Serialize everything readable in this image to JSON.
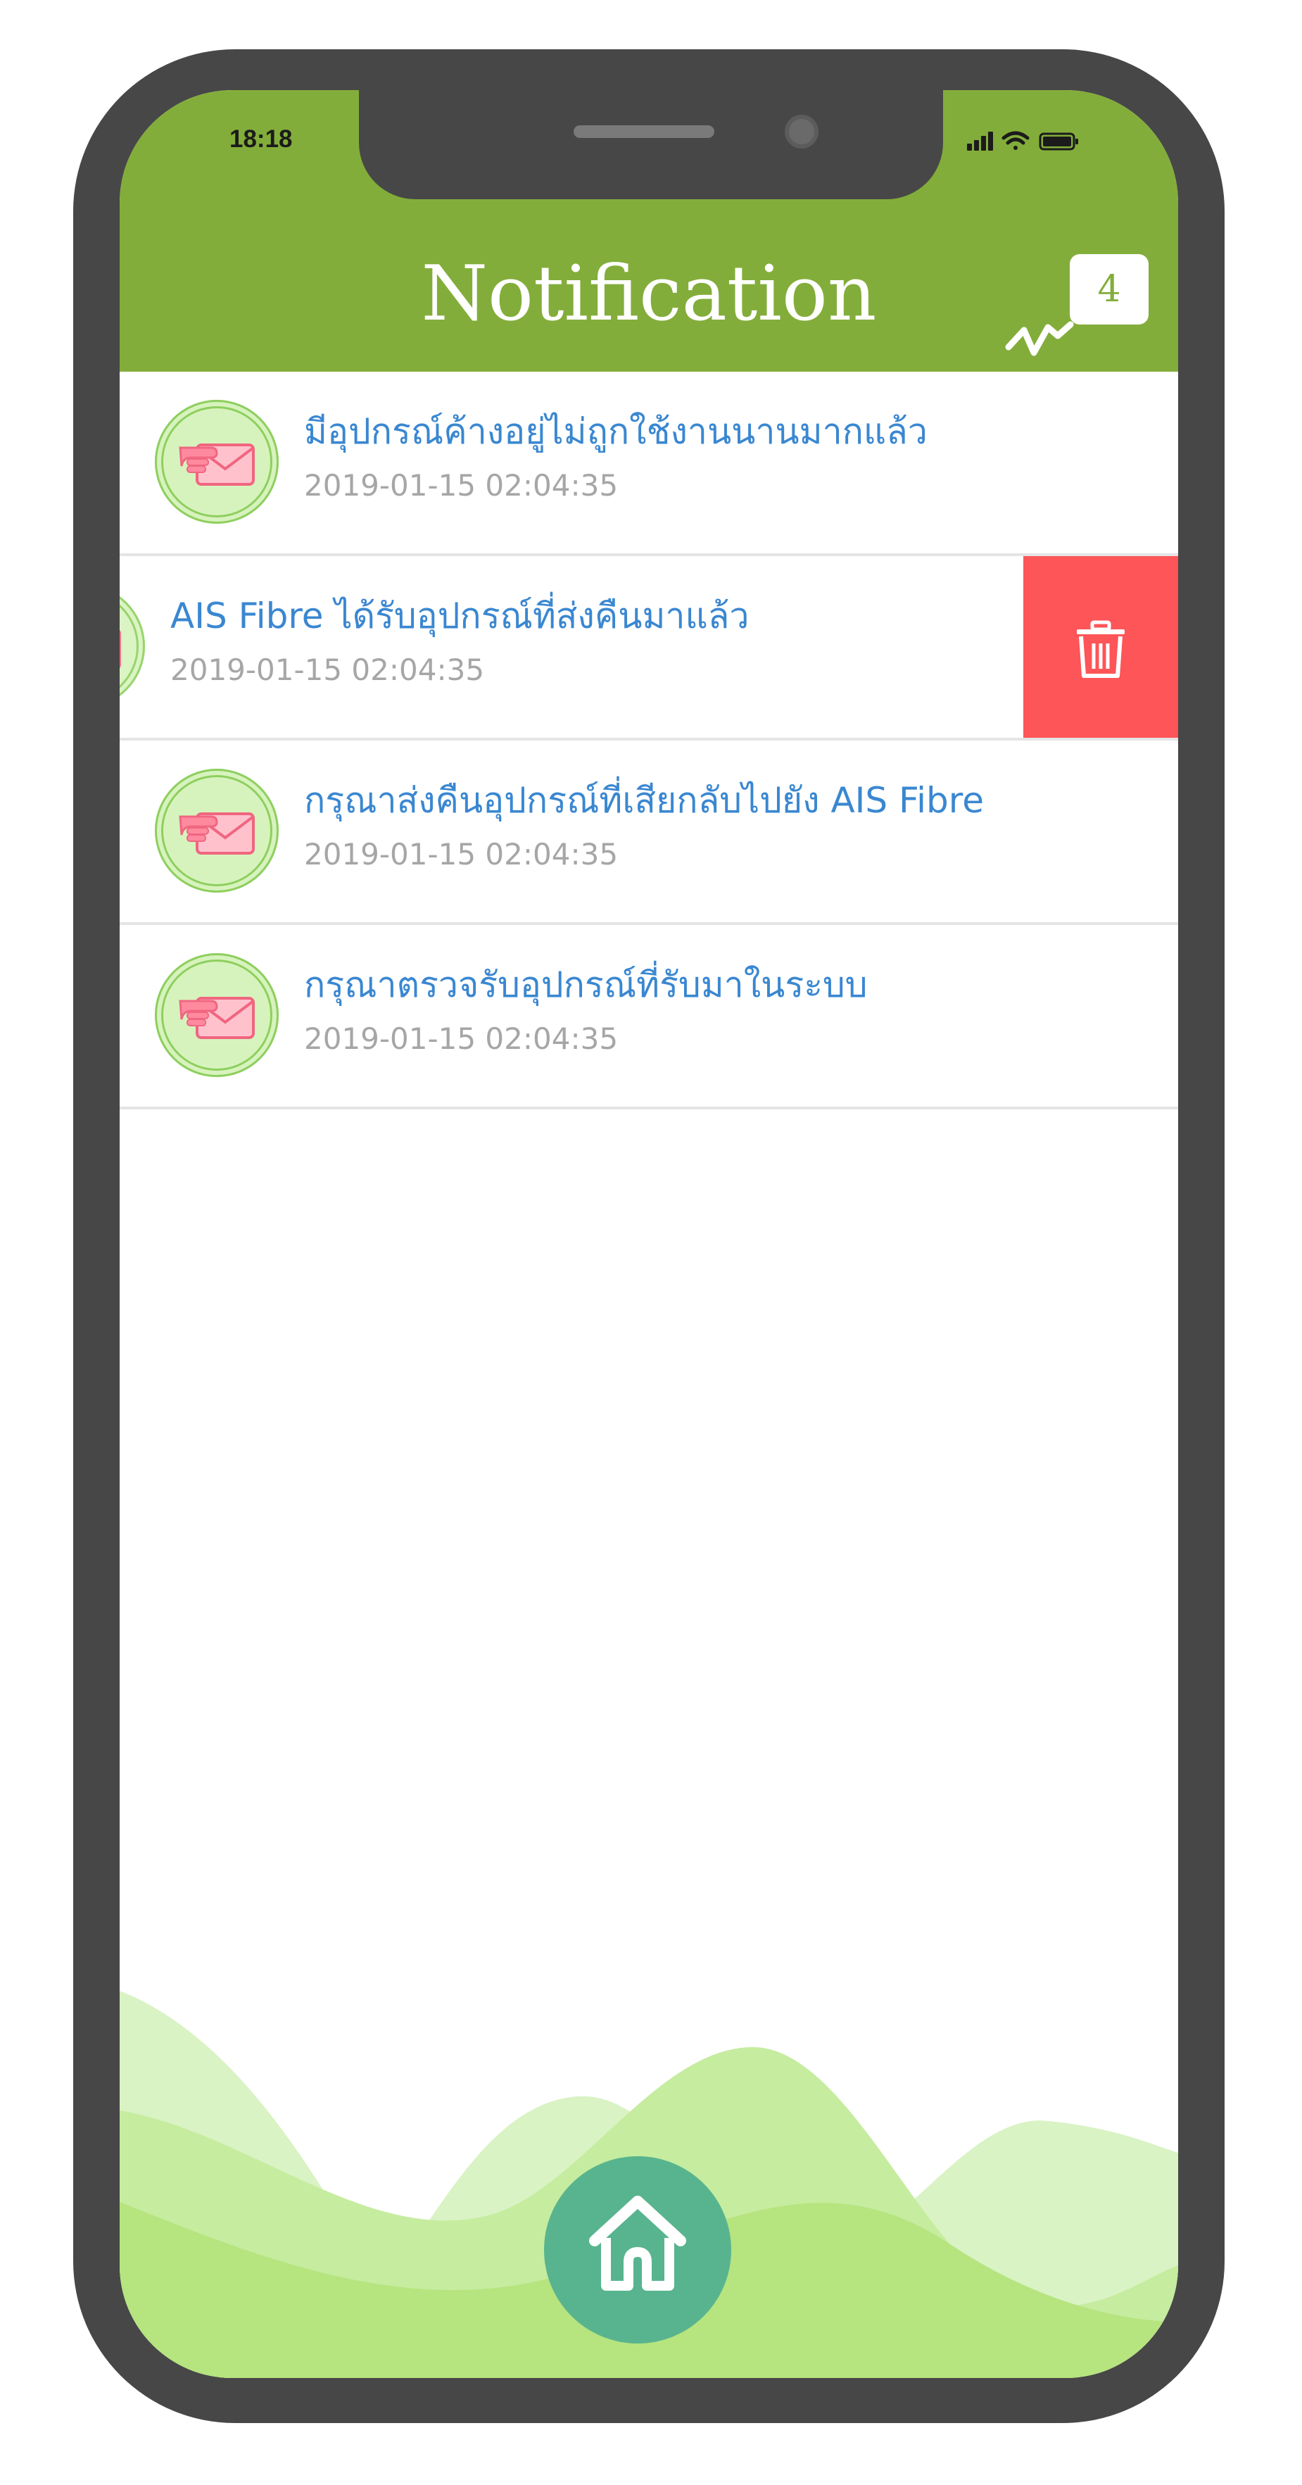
{
  "status_bar": {
    "time": "18:18"
  },
  "header": {
    "title": "Notification",
    "badge_count": "4"
  },
  "notifications": [
    {
      "message": "มีอุปกรณ์ค้างอยู่ไม่ถูกใช้งานนานมากแล้ว",
      "datetime": "2019-01-15 02:04:35",
      "icon": "mail-hand-icon",
      "swiped": false
    },
    {
      "message": "AIS Fibre ได้รับอุปกรณ์ที่ส่งคืนมาแล้ว",
      "datetime": "2019-01-15 02:04:35",
      "icon": "mail-hand-icon",
      "swiped": true
    },
    {
      "message": "กรุณาส่งคืนอุปกรณ์ที่เสียกลับไปยัง AIS Fibre",
      "datetime": "2019-01-15 02:04:35",
      "icon": "mail-hand-icon",
      "swiped": false
    },
    {
      "message": "กรุณาตรวจรับอุปกรณ์ที่รับมาในระบบ",
      "datetime": "2019-01-15 02:04:35",
      "icon": "mail-hand-icon",
      "swiped": false
    }
  ],
  "delete_action": {
    "icon": "trash-icon"
  },
  "bottom_nav": {
    "home_icon": "home-icon"
  },
  "colors": {
    "header_green": "#83ad3a",
    "message_blue": "#3a87d1",
    "date_gray": "#a6a6a6",
    "delete_red": "#fd5558",
    "home_teal": "#58b48e",
    "wave_light": "#d9f3c4",
    "wave_mid": "#c6ec9f",
    "wave_dark": "#b6e47f"
  }
}
